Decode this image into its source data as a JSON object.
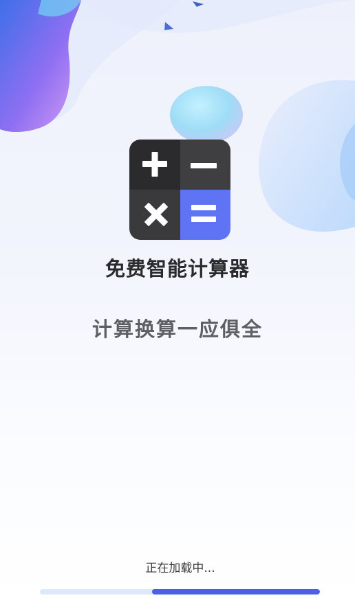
{
  "app": {
    "title": "免费智能计算器",
    "slogan": "计算换算一应俱全"
  },
  "app_icon": {
    "name": "calculator-app-icon",
    "symbols": [
      "plus",
      "minus",
      "multiply",
      "equals"
    ]
  },
  "loading": {
    "text": "正在加载中...",
    "progress_fraction": 0.6
  },
  "colors": {
    "accent": "#5f73f5",
    "progress_fill": "#4f5ee6",
    "progress_track": "#dde8fb",
    "title_text": "#2a2a2c",
    "slogan_text": "#5d5f63"
  }
}
